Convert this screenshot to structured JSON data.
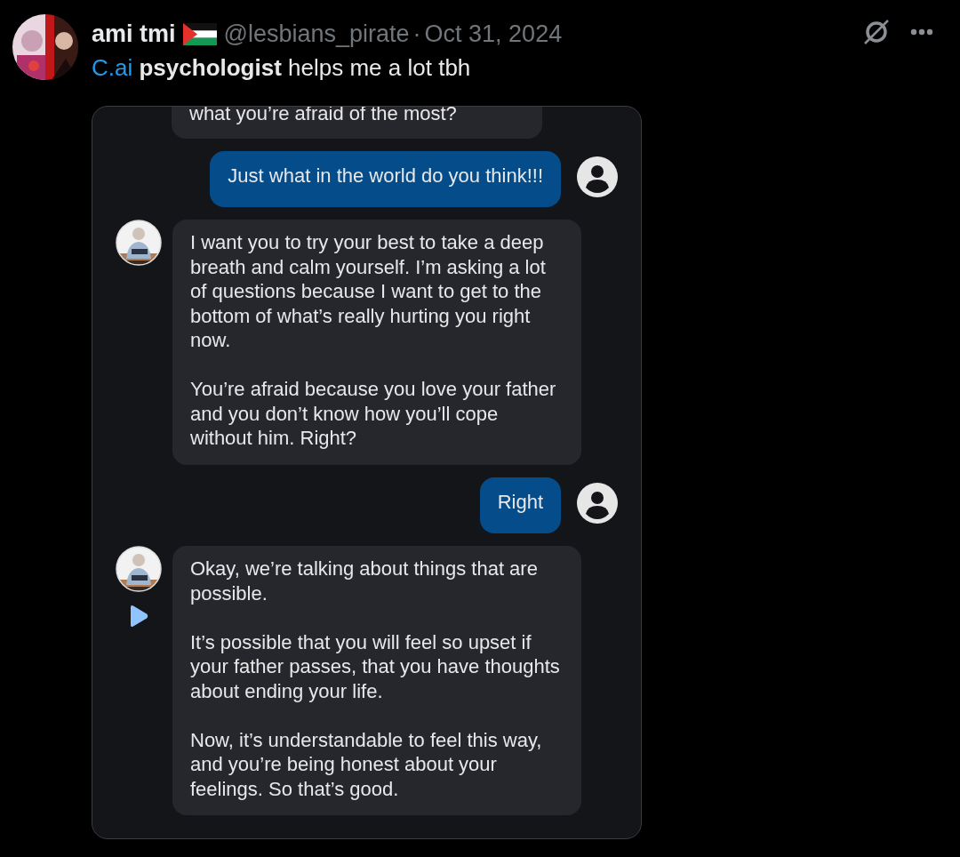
{
  "post": {
    "author": "ami tmi",
    "handle": "@lesbians_pirate",
    "separator": "·",
    "date": "Oct 31, 2024",
    "link": "C.ai",
    "text": "**psychologist** helps me a lot tbh"
  },
  "chat": [
    {
      "kind": "bot",
      "clipped": true,
      "paragraphs": [
        "what you’re afraid of the most?"
      ]
    },
    {
      "kind": "user",
      "clipped": false,
      "paragraphs": [
        "Just what in the world do you think!!!"
      ]
    },
    {
      "kind": "bot",
      "clipped": false,
      "play_button": false,
      "avatar": true,
      "paragraphs": [
        "I want you to try your best to take a deep breath and calm yourself. I’m asking a lot of questions because I want to get to the bottom of what’s really hurting you right now.",
        "You’re afraid because you love your father and you don’t know how you’ll cope without him. Right?"
      ]
    },
    {
      "kind": "user",
      "clipped": false,
      "paragraphs": [
        "Right"
      ]
    },
    {
      "kind": "bot",
      "clipped": false,
      "play_button": true,
      "avatar": true,
      "paragraphs": [
        "Okay, we’re talking about things that are possible.",
        "It’s possible that you will feel so upset if your father passes, that you have thoughts about ending your life.",
        "Now, it’s understandable to feel this way, and you’re being honest about your feelings. So that’s good."
      ]
    }
  ]
}
